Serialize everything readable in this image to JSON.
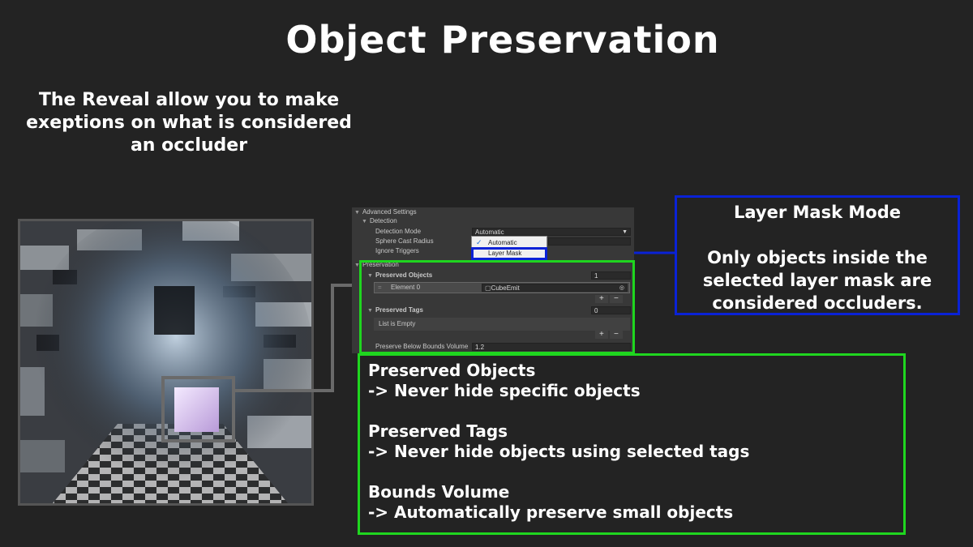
{
  "title": "Object Preservation",
  "intro": [
    "The Reveal allow you to make",
    "exeptions on what is considered",
    "an occluder"
  ],
  "inspector": {
    "advanced": "Advanced Settings",
    "detection": "Detection",
    "detection_mode_label": "Detection Mode",
    "detection_mode_value": "Automatic",
    "sphere_cast_label": "Sphere Cast Radius",
    "ignore_triggers_label": "Ignore Triggers",
    "popup_options": [
      "Automatic",
      "Layer Mask"
    ],
    "popup_selected": "Automatic",
    "preservation": "Preservation",
    "preserved_objects_label": "Preserved Objects",
    "preserved_objects_count": "1",
    "element0_label": "Element 0",
    "element0_value": "CubeEmit",
    "preserved_tags_label": "Preserved Tags",
    "preserved_tags_count": "0",
    "list_empty": "List is Empty",
    "bounds_label": "Preserve Below Bounds Volume",
    "bounds_value": "1.2",
    "plus": "+",
    "minus": "−"
  },
  "callout_layer": {
    "heading": "Layer Mask Mode",
    "body": [
      "Only objects inside the",
      "selected layer mask are",
      "considered occluders."
    ]
  },
  "callout_preserve": [
    {
      "heading": "Preserved Objects",
      "body": "-> Never hide specific objects"
    },
    {
      "heading": "Preserved Tags",
      "body": "-> Never hide objects using selected tags"
    },
    {
      "heading": "Bounds Volume",
      "body": "-> Automatically preserve small objects"
    }
  ],
  "colors": {
    "blue": "#0a22d6",
    "green": "#1fd61f",
    "background": "#232323"
  }
}
